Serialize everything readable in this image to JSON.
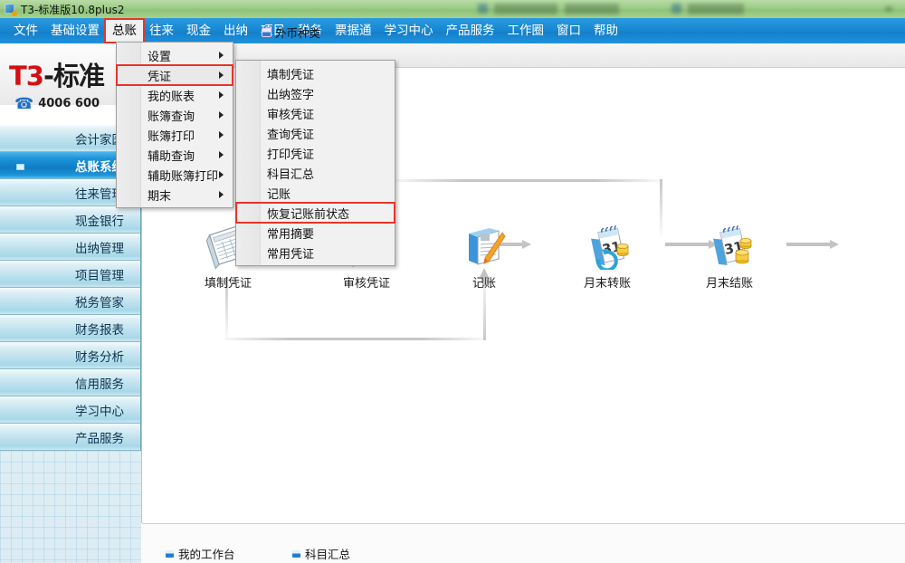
{
  "window": {
    "title": "T3-标准版10.8plus2",
    "app_icon": "app-icon"
  },
  "menubar": {
    "items": [
      {
        "label": "文件",
        "open": false
      },
      {
        "label": "基础设置",
        "open": false
      },
      {
        "label": "总账",
        "open": true
      },
      {
        "label": "往来",
        "open": false
      },
      {
        "label": "现金",
        "open": false
      },
      {
        "label": "出纳",
        "open": false
      },
      {
        "label": "项目",
        "open": false
      },
      {
        "label": "税务",
        "open": false
      },
      {
        "label": "票据通",
        "open": false
      },
      {
        "label": "学习中心",
        "open": false
      },
      {
        "label": "产品服务",
        "open": false
      },
      {
        "label": "工作圈",
        "open": false
      },
      {
        "label": "窗口",
        "open": false
      },
      {
        "label": "帮助",
        "open": false
      }
    ]
  },
  "branding": {
    "logo_prefix": "T3",
    "logo_dash": "-",
    "logo_suffix": "标准",
    "hotline": "4006 600",
    "phone_icon": "phone-icon"
  },
  "tabstrip": {
    "foreign_currency_label": "外币种类",
    "bullet_icon": "window-bullet-icon"
  },
  "sidebar": {
    "items": [
      {
        "label": "会计家园",
        "selected": false
      },
      {
        "label": "总账系统",
        "selected": true
      },
      {
        "label": "往来管理",
        "selected": false
      },
      {
        "label": "现金银行",
        "selected": false
      },
      {
        "label": "出纳管理",
        "selected": false
      },
      {
        "label": "项目管理",
        "selected": false
      },
      {
        "label": "税务管家",
        "selected": false
      },
      {
        "label": "财务报表",
        "selected": false
      },
      {
        "label": "财务分析",
        "selected": false
      },
      {
        "label": "信用服务",
        "selected": false
      },
      {
        "label": "学习中心",
        "selected": false
      },
      {
        "label": "产品服务",
        "selected": false
      }
    ]
  },
  "menu_main": {
    "title": "总账",
    "items": [
      {
        "label": "设置",
        "submenu": true,
        "highlighted": false
      },
      {
        "label": "凭证",
        "submenu": true,
        "highlighted": true
      },
      {
        "label": "我的账表",
        "submenu": true,
        "highlighted": false
      },
      {
        "label": "账簿查询",
        "submenu": true,
        "highlighted": false
      },
      {
        "label": "账簿打印",
        "submenu": true,
        "highlighted": false
      },
      {
        "label": "辅助查询",
        "submenu": true,
        "highlighted": false
      },
      {
        "label": "辅助账簿打印",
        "submenu": true,
        "highlighted": false
      },
      {
        "label": "期末",
        "submenu": true,
        "highlighted": false
      }
    ]
  },
  "menu_sub": {
    "parent": "凭证",
    "items": [
      {
        "label": "填制凭证",
        "boxed": false
      },
      {
        "label": "出纳签字",
        "boxed": false
      },
      {
        "label": "审核凭证",
        "boxed": false
      },
      {
        "label": "查询凭证",
        "boxed": false
      },
      {
        "label": "打印凭证",
        "boxed": false
      },
      {
        "label": "科目汇总",
        "boxed": false
      },
      {
        "label": "记账",
        "boxed": false
      },
      {
        "label": "恢复记账前状态",
        "boxed": true
      },
      {
        "label": "常用摘要",
        "boxed": false
      },
      {
        "label": "常用凭证",
        "boxed": false
      }
    ]
  },
  "workflow": {
    "nodes": [
      {
        "label": "填制凭证",
        "icon": "voucher-entry-icon"
      },
      {
        "label": "审核凭证",
        "icon": "voucher-audit-icon"
      },
      {
        "label": "记账",
        "icon": "bookkeeping-icon"
      },
      {
        "label": "月末转账",
        "icon": "month-end-transfer-icon"
      },
      {
        "label": "月末结账",
        "icon": "month-end-closing-icon"
      }
    ]
  },
  "dock": {
    "items": [
      {
        "label": "我的工作台",
        "icon": "workbench-bullet-icon"
      },
      {
        "label": "科目汇总",
        "icon": "subject-summary-bullet-icon"
      }
    ]
  },
  "colors": {
    "titlebar": "#9ccb86",
    "menubar": "#1a8ad4",
    "sidebar_selected": "#0f7cc4",
    "highlight_box": "#e8342a",
    "logo_red": "#d40f13",
    "arrow_gray": "#c3c3c3"
  }
}
